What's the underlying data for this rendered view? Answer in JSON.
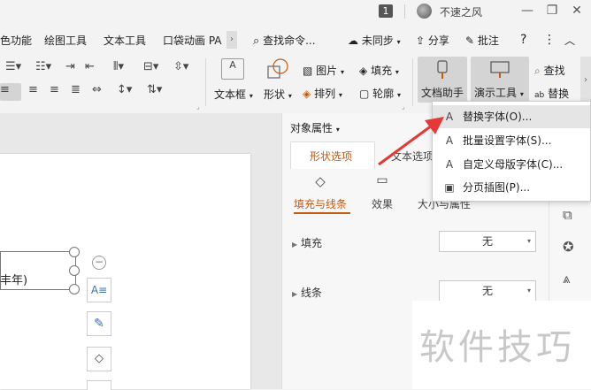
{
  "titlebar": {
    "badge": "1",
    "username": "不速之风",
    "minimize": "—",
    "restore": "❐",
    "close": "✕"
  },
  "menu": {
    "items": [
      "色功能",
      "绘图工具",
      "文本工具",
      "口袋动画 PA"
    ],
    "chevron": "›",
    "search": "查找命令...",
    "sync": "未同步",
    "share": "分享",
    "comment": "批注",
    "help": "?",
    "more": "⋮",
    "collapse": "︿"
  },
  "ribbon": {
    "textbox": "文本框",
    "shape": "形状",
    "picture": "图片",
    "fill": "填充",
    "arrange": "排列",
    "outline": "轮廓",
    "doc_helper": "文档助手",
    "present_tools": "演示工具",
    "find": "查找",
    "replace": "替换",
    "more": "›"
  },
  "context_menu": {
    "items": [
      {
        "icon": "A",
        "label": "替换字体(O)..."
      },
      {
        "icon": "A",
        "label": "批量设置字体(S)..."
      },
      {
        "icon": "A",
        "label": "自定义母版字体(C)..."
      },
      {
        "icon": "▣",
        "label": "分页插图(P)..."
      }
    ]
  },
  "panel": {
    "title": "对象属性",
    "tabs": [
      "形状选项",
      "文本选项"
    ],
    "subtabs": [
      "填充与线条",
      "效果",
      "大小与属性"
    ],
    "fill_label": "填充",
    "fill_value": "无",
    "line_label": "线条",
    "line_value": "无"
  },
  "slide": {
    "textbox_text": "丰年)"
  },
  "watermark": "软件技巧",
  "colors": {
    "accent": "#c55a11",
    "arrow": "#e53935"
  }
}
